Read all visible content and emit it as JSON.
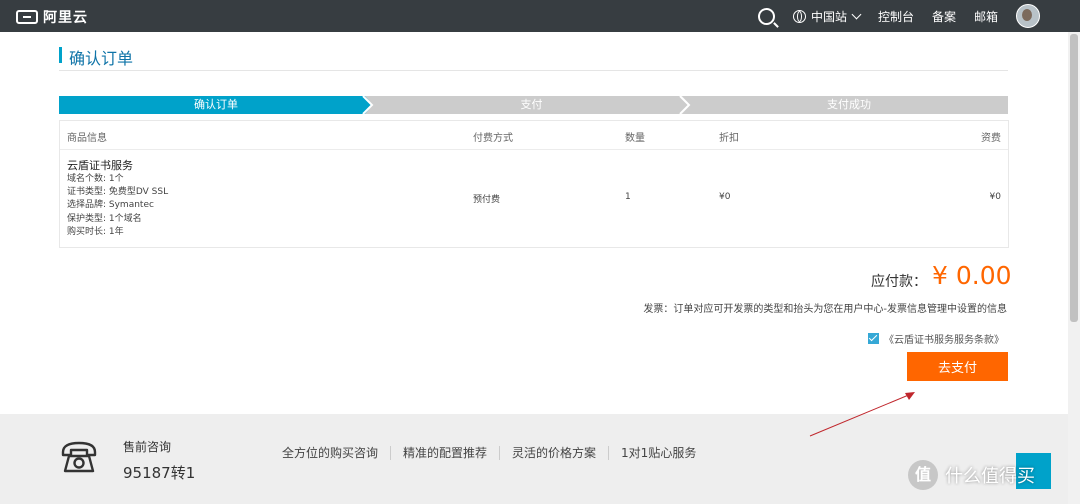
{
  "header": {
    "logo_text": "阿里云",
    "region": "中国站",
    "links": [
      "控制台",
      "备案",
      "邮箱"
    ]
  },
  "page_title": "确认订单",
  "steps": [
    "确认订单",
    "支付",
    "支付成功"
  ],
  "table": {
    "headers": [
      "商品信息",
      "付费方式",
      "数量",
      "折扣",
      "资费"
    ],
    "product_name": "云盾证书服务",
    "specs": [
      "域名个数: 1个",
      "证书类型: 免费型DV SSL",
      "选择品牌: Symantec",
      "保护类型: 1个域名",
      "购买时长: 1年"
    ],
    "payment_method": "预付费",
    "quantity": "1",
    "discount": "¥0",
    "fee": "¥0"
  },
  "payment": {
    "label": "应付款：",
    "amount": "¥ 0.00",
    "invoice_note": "发票：订单对应可开发票的类型和抬头为您在用户中心-发票信息管理中设置的信息",
    "agreement": "《云盾证书服务服务条款》",
    "button": "去支付"
  },
  "footer": {
    "consult_label": "售前咨询",
    "consult_phone": "95187转1",
    "features": [
      "全方位的购买咨询",
      "精准的配置推荐",
      "灵活的价格方案",
      "1对1贴心服务"
    ]
  },
  "watermark": {
    "glyph": "值",
    "text": "什么值得买"
  },
  "colors": {
    "topbar": "#373d41",
    "accent_blue": "#00a2ca",
    "step_active": "#00a2ca",
    "step_inactive": "#cccccc",
    "pay_orange": "#ff6600",
    "arrow_red": "#c0262c"
  },
  "icons": [
    "search-icon",
    "globe-icon",
    "chevron-down-icon",
    "phone-icon",
    "checkbox-checked-icon"
  ]
}
